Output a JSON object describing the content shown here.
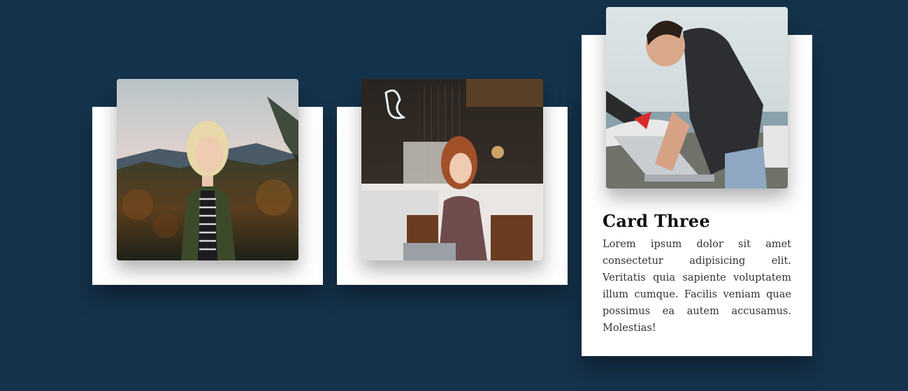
{
  "cards": [
    {
      "photo_icon": "portrait-woman-forest-photo",
      "title": "",
      "text": ""
    },
    {
      "photo_icon": "woman-cafe-laptop-photo",
      "title": "",
      "text": ""
    },
    {
      "photo_icon": "man-laptop-outdoors-photo",
      "title": "Card Three",
      "text": "Lorem ipsum dolor sit amet consectetur adipisicing elit. Veritatis quia sapiente voluptatem illum cumque. Facilis veniam quae possimus ea autem accusamus. Molestias!"
    }
  ],
  "colors": {
    "background": "#15334c",
    "card": "#ffffff",
    "title": "#111111",
    "text": "#333333"
  }
}
